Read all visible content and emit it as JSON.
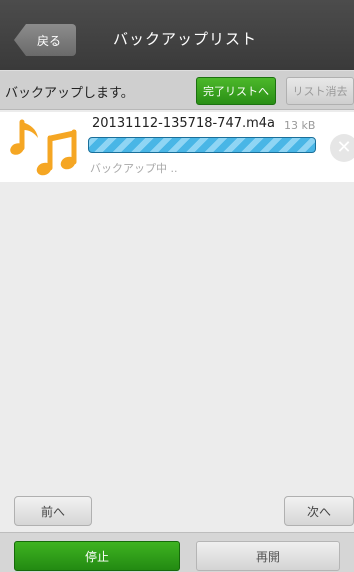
{
  "header": {
    "back_label": "戻る",
    "title": "バックアップリスト"
  },
  "status_bar": {
    "message": "バックアップします。",
    "done_list_label": "完了リストへ",
    "clear_list_label": "リスト消去"
  },
  "backup_items": [
    {
      "file_name": "20131112-135718-747.m4a",
      "size": "13 kB",
      "status": "バックアップ中 ..",
      "icon": "music-note-icon"
    }
  ],
  "pager": {
    "prev_label": "前へ",
    "next_label": "次へ"
  },
  "bottom_bar": {
    "stop_label": "停止",
    "resume_label": "再開"
  },
  "colors": {
    "header_bg": "#3f3f3f",
    "accent_green": "#2f9a18",
    "progress_blue": "#49b6e6",
    "icon_orange": "#f5a623"
  }
}
